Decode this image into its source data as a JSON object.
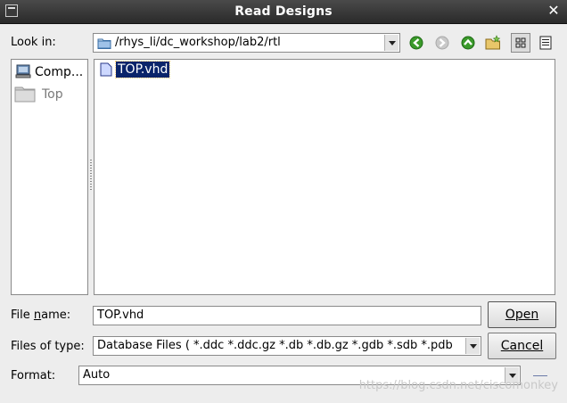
{
  "window": {
    "title": "Read Designs"
  },
  "look_in": {
    "label": "Look in:",
    "path": "/rhys_li/dc_workshop/lab2/rtl"
  },
  "toolbar": {
    "back_icon": "arrow-left-icon",
    "forward_icon": "arrow-right-icon",
    "up_icon": "arrow-up-icon",
    "new_folder_icon": "new-folder-icon",
    "list_view_icon": "list-view-icon",
    "detail_view_icon": "detail-view-icon"
  },
  "sidebar": {
    "items": [
      {
        "label": "Comp...",
        "icon": "computer-icon"
      },
      {
        "label": "Top",
        "icon": "folder-icon"
      }
    ]
  },
  "files": [
    {
      "name": "TOP.vhd",
      "icon": "file-icon",
      "selected": true
    }
  ],
  "file_name": {
    "label": "File name:",
    "value": "TOP.vhd"
  },
  "files_of_type": {
    "label": "Files of type:",
    "value": "Database Files ( *.ddc *.ddc.gz *.db *.db.gz *.gdb *.sdb *.pdb"
  },
  "format": {
    "label": "Format:",
    "value": "Auto"
  },
  "buttons": {
    "open": "Open",
    "cancel": "Cancel"
  },
  "watermark": "https://blog.csdn.net/ciscomonkey",
  "colors": {
    "titlebar": "#2f2f2f",
    "selection": "#0a246a",
    "accent_green": "#3a9a2a"
  }
}
